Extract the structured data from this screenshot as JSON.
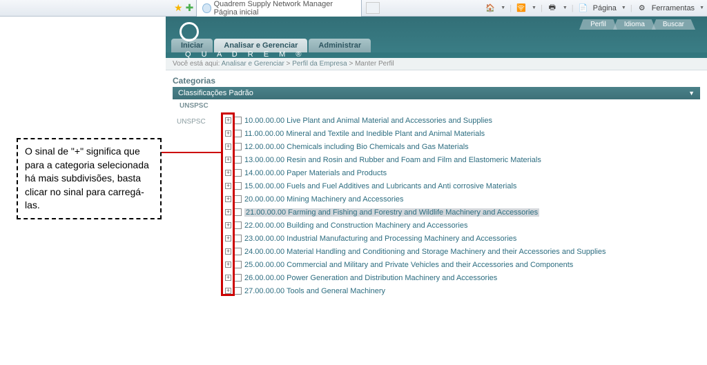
{
  "ie": {
    "tab_title": "Quadrem Supply Network Manager Página inicial",
    "right": {
      "pagina": "Página",
      "ferramentas": "Ferramentas"
    }
  },
  "callout": {
    "text": "O sinal de \"+\" significa que para a categoria selecionada há mais subdivisões, basta clicar no sinal para carregá-las."
  },
  "header": {
    "brand": "Q U A D R E M ®",
    "top_nav": [
      "Perfil",
      "Idioma",
      "Buscar"
    ]
  },
  "main_tabs": [
    {
      "label": "Iniciar",
      "active": false
    },
    {
      "label": "Analisar e Gerenciar",
      "active": true
    },
    {
      "label": "Administrar",
      "active": false
    }
  ],
  "breadcrumb": {
    "prefix": "Você está aqui:",
    "items": [
      "Analisar e Gerenciar",
      "Perfil da Empresa",
      "Manter Perfil"
    ]
  },
  "section": {
    "title": "Categorias",
    "bar": "Classificações Padrão",
    "sub": "UNSPSC"
  },
  "tree": {
    "root_label": "UNSPSC",
    "rows": [
      {
        "code": "10.00.00.00",
        "label": "Live Plant and Animal Material and Accessories and Supplies",
        "hl": false
      },
      {
        "code": "11.00.00.00",
        "label": "Mineral and Textile and Inedible Plant and Animal Materials",
        "hl": false
      },
      {
        "code": "12.00.00.00",
        "label": "Chemicals including Bio Chemicals and Gas Materials",
        "hl": false
      },
      {
        "code": "13.00.00.00",
        "label": "Resin and Rosin and Rubber and Foam and Film and Elastomeric Materials",
        "hl": false
      },
      {
        "code": "14.00.00.00",
        "label": "Paper Materials and Products",
        "hl": false
      },
      {
        "code": "15.00.00.00",
        "label": "Fuels and Fuel Additives and Lubricants and Anti corrosive Materials",
        "hl": false
      },
      {
        "code": "20.00.00.00",
        "label": "Mining Machinery and Accessories",
        "hl": false
      },
      {
        "code": "21.00.00.00",
        "label": "Farming and Fishing and Forestry and Wildlife Machinery and Accessories",
        "hl": true
      },
      {
        "code": "22.00.00.00",
        "label": "Building and Construction Machinery and Accessories",
        "hl": false
      },
      {
        "code": "23.00.00.00",
        "label": "Industrial Manufacturing and Processing Machinery and Accessories",
        "hl": false
      },
      {
        "code": "24.00.00.00",
        "label": "Material Handling and Conditioning and Storage Machinery and their Accessories and Supplies",
        "hl": false
      },
      {
        "code": "25.00.00.00",
        "label": "Commercial and Military and Private Vehicles and their Accessories and Components",
        "hl": false
      },
      {
        "code": "26.00.00.00",
        "label": "Power Generation and Distribution Machinery and Accessories",
        "hl": false
      },
      {
        "code": "27.00.00.00",
        "label": "Tools and General Machinery",
        "hl": false
      }
    ]
  }
}
